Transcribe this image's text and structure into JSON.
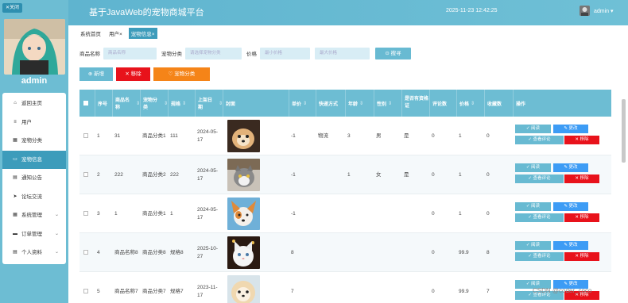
{
  "app": {
    "title": "基于JavaWeb的宠物商城平台",
    "datetime": "2025-11-23 12:42:25",
    "user": "admin",
    "user_chevron": "▾"
  },
  "sidebar": {
    "close_label": "✕关闭",
    "admin_name": "admin",
    "items": [
      {
        "label": "返回主页",
        "icon": "home-icon",
        "glyph": "⌂"
      },
      {
        "label": "用户",
        "icon": "list-icon",
        "glyph": "≡"
      },
      {
        "label": "宠物分类",
        "icon": "grid-icon",
        "glyph": "▦"
      },
      {
        "label": "宠物信息",
        "icon": "monitor-icon",
        "glyph": "▭"
      },
      {
        "label": "通知公告",
        "icon": "calendar-icon",
        "glyph": "▤"
      },
      {
        "label": "论坛交流",
        "icon": "send-icon",
        "glyph": "➤"
      },
      {
        "label": "系统管理",
        "icon": "apps-icon",
        "glyph": "▦"
      },
      {
        "label": "订单管理",
        "icon": "briefcase-icon",
        "glyph": "▬"
      },
      {
        "label": "个人资料",
        "icon": "document-icon",
        "glyph": "▤"
      }
    ],
    "chevron": "⌄"
  },
  "breadcrumb": [
    "系统首页",
    "用户×",
    "宠物信息×"
  ],
  "search": {
    "name_label": "商品名称",
    "name_placeholder": "商品名称",
    "cat_label": "宠物分类",
    "cat_placeholder": "请选择宠物分类",
    "price_label": "价格",
    "price_min_placeholder": "最小价格",
    "price_max_placeholder": "最大价格",
    "search_label": "⊙ 搜寻"
  },
  "actions": {
    "add": "⊕ 新增",
    "delete": "✕ 移除",
    "category": "♡ 宠物分类"
  },
  "table": {
    "headers": [
      "序号",
      "商品名称",
      "宠物分类",
      "规格",
      "上架日期",
      "封面",
      "单价",
      "快递方式",
      "年龄",
      "性别",
      "是否有资格证",
      "评论数",
      "价格",
      "收藏数",
      "操作"
    ],
    "sort_glyph": "⇕",
    "ops": {
      "view": "✓ 阅读",
      "edit": "✎ 更改",
      "comment": "✓ 查看评论",
      "remove": "✕ 移除"
    },
    "rows": [
      {
        "no": "1",
        "name": "31",
        "cat": "商品分类1",
        "spec": "111",
        "date": "2024-05-17",
        "unit": "-1",
        "ship": "物流",
        "age": "3",
        "sex": "男",
        "cert": "是",
        "comments": "0",
        "price": "1",
        "fav": "0"
      },
      {
        "no": "2",
        "name": "222",
        "cat": "商品分类2",
        "spec": "222",
        "date": "2024-05-17",
        "unit": "-1",
        "ship": "",
        "age": "1",
        "sex": "女",
        "cert": "是",
        "comments": "0",
        "price": "1",
        "fav": "0"
      },
      {
        "no": "3",
        "name": "1",
        "cat": "商品分类1",
        "spec": "1",
        "date": "2024-05-17",
        "unit": "-1",
        "ship": "",
        "age": "",
        "sex": "",
        "cert": "",
        "comments": "0",
        "price": "1",
        "fav": "0"
      },
      {
        "no": "4",
        "name": "商品名称8",
        "cat": "商品分类8",
        "spec": "规格8",
        "date": "2025-10-27",
        "unit": "8",
        "ship": "",
        "age": "",
        "sex": "",
        "cert": "",
        "comments": "0",
        "price": "99.9",
        "fav": "8"
      },
      {
        "no": "5",
        "name": "商品名称7",
        "cat": "商品分类7",
        "spec": "规格7",
        "date": "2023-11-17",
        "unit": "7",
        "ship": "",
        "age": "",
        "sex": "",
        "cert": "",
        "comments": "0",
        "price": "99.9",
        "fav": "7"
      }
    ]
  },
  "watermark": "CSDN @coder_coco"
}
